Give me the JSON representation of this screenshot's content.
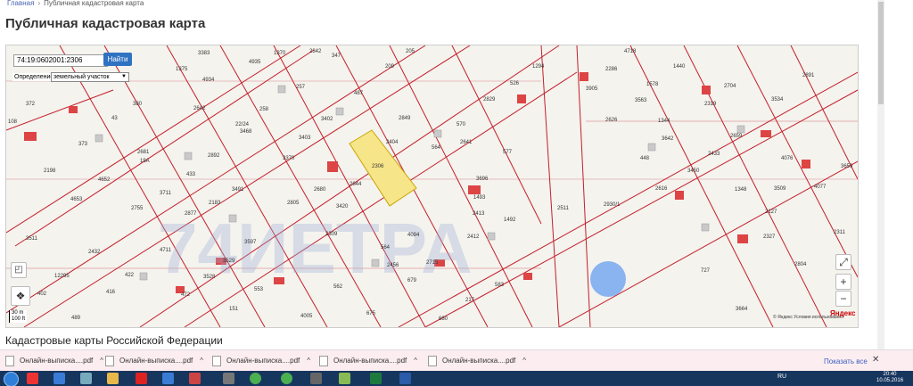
{
  "breadcrumb": {
    "home": "Главная",
    "separator": "›",
    "current": "Публичная кадастровая карта"
  },
  "page": {
    "title": "Публичная кадастровая карта",
    "section_title": "Кадастровые карты Российской Федерации"
  },
  "search": {
    "value": "74:19:0602001:2306",
    "button_label": "Найти"
  },
  "definition": {
    "label": "Определение",
    "selected": "земельный участок"
  },
  "map": {
    "labels": [
      {
        "id": "3383",
        "t": "3383"
      },
      {
        "id": "2342",
        "t": "2342"
      },
      {
        "id": "347",
        "t": "347"
      },
      {
        "id": "209",
        "t": "209"
      },
      {
        "id": "205",
        "t": "205"
      },
      {
        "id": "1294",
        "t": "1294"
      },
      {
        "id": "4718",
        "t": "4718"
      },
      {
        "id": "1440",
        "t": "1440"
      },
      {
        "id": "2891",
        "t": "2891"
      },
      {
        "id": "1375",
        "t": "1375"
      },
      {
        "id": "4935",
        "t": "4935"
      },
      {
        "id": "1370",
        "t": "1370"
      },
      {
        "id": "3905",
        "t": "3905"
      },
      {
        "id": "2286",
        "t": "2286"
      },
      {
        "id": "1578",
        "t": "1578"
      },
      {
        "id": "2704",
        "t": "2704"
      },
      {
        "id": "3534",
        "t": "3534"
      },
      {
        "id": "4934",
        "t": "4934"
      },
      {
        "id": "257",
        "t": "257"
      },
      {
        "id": "487",
        "t": "487"
      },
      {
        "id": "2829",
        "t": "2829"
      },
      {
        "id": "526",
        "t": "526"
      },
      {
        "id": "3563",
        "t": "3563"
      },
      {
        "id": "2319",
        "t": "2319"
      },
      {
        "id": "372",
        "t": "372"
      },
      {
        "id": "380",
        "t": "380"
      },
      {
        "id": "2642",
        "t": "2642"
      },
      {
        "id": "258",
        "t": "258"
      },
      {
        "id": "3402",
        "t": "3402"
      },
      {
        "id": "2849",
        "t": "2849"
      },
      {
        "id": "2626",
        "t": "2626"
      },
      {
        "id": "1344",
        "t": "1344"
      },
      {
        "id": "108",
        "t": "108"
      },
      {
        "id": "43",
        "t": "43"
      },
      {
        "id": "22/24",
        "t": "22/24"
      },
      {
        "id": "3468",
        "t": "3468"
      },
      {
        "id": "570",
        "t": "570"
      },
      {
        "id": "3642",
        "t": "3642"
      },
      {
        "id": "2659",
        "t": "2659"
      },
      {
        "id": "373",
        "t": "373"
      },
      {
        "id": "3403",
        "t": "3403"
      },
      {
        "id": "2404",
        "t": "2404"
      },
      {
        "id": "564",
        "t": "564"
      },
      {
        "id": "577",
        "t": "577"
      },
      {
        "id": "448",
        "t": "448"
      },
      {
        "id": "2433",
        "t": "2433"
      },
      {
        "id": "2681",
        "t": "2681"
      },
      {
        "id": "19А",
        "t": "19А"
      },
      {
        "id": "2892",
        "t": "2892"
      },
      {
        "id": "2306",
        "t": "2306"
      },
      {
        "id": "3370",
        "t": "3370"
      },
      {
        "id": "2641",
        "t": "2641"
      },
      {
        "id": "3450",
        "t": "3450"
      },
      {
        "id": "4076",
        "t": "4076"
      },
      {
        "id": "3659",
        "t": "3659"
      },
      {
        "id": "2198",
        "t": "2198"
      },
      {
        "id": "4652",
        "t": "4652"
      },
      {
        "id": "433",
        "t": "433"
      },
      {
        "id": "2680",
        "t": "2680"
      },
      {
        "id": "2644",
        "t": "2644"
      },
      {
        "id": "3696",
        "t": "3696"
      },
      {
        "id": "2616",
        "t": "2616"
      },
      {
        "id": "1348",
        "t": "1348"
      },
      {
        "id": "3509",
        "t": "3509"
      },
      {
        "id": "4077",
        "t": "4077"
      },
      {
        "id": "4653",
        "t": "4653"
      },
      {
        "id": "3711",
        "t": "3711"
      },
      {
        "id": "3491",
        "t": "3491"
      },
      {
        "id": "2183",
        "t": "2183"
      },
      {
        "id": "2805",
        "t": "2805"
      },
      {
        "id": "3420",
        "t": "3420"
      },
      {
        "id": "1493",
        "t": "1493"
      },
      {
        "id": "2511",
        "t": "2511"
      },
      {
        "id": "2930/1",
        "t": "2930/1"
      },
      {
        "id": "2755",
        "t": "2755"
      },
      {
        "id": "2877",
        "t": "2877"
      },
      {
        "id": "2413",
        "t": "2413"
      },
      {
        "id": "1492",
        "t": "1492"
      },
      {
        "id": "2127",
        "t": "2127"
      },
      {
        "id": "2311",
        "t": "2311"
      },
      {
        "id": "3511",
        "t": "3511"
      },
      {
        "id": "4711",
        "t": "4711"
      },
      {
        "id": "3597",
        "t": "3597"
      },
      {
        "id": "2309",
        "t": "2309"
      },
      {
        "id": "4094",
        "t": "4094"
      },
      {
        "id": "2412",
        "t": "2412"
      },
      {
        "id": "2327",
        "t": "2327"
      },
      {
        "id": "2432",
        "t": "2432"
      },
      {
        "id": "3529",
        "t": "3529"
      },
      {
        "id": "564b",
        "t": "564"
      },
      {
        "id": "2456",
        "t": "2456"
      },
      {
        "id": "2715",
        "t": "2715"
      },
      {
        "id": "727",
        "t": "727"
      },
      {
        "id": "2804",
        "t": "2804"
      },
      {
        "id": "12295",
        "t": "12295"
      },
      {
        "id": "422",
        "t": "422"
      },
      {
        "id": "3528",
        "t": "3528"
      },
      {
        "id": "679",
        "t": "679"
      },
      {
        "id": "583",
        "t": "583"
      },
      {
        "id": "402",
        "t": "402"
      },
      {
        "id": "416",
        "t": "416"
      },
      {
        "id": "472",
        "t": "472"
      },
      {
        "id": "553",
        "t": "553"
      },
      {
        "id": "562",
        "t": "562"
      },
      {
        "id": "217",
        "t": "217"
      },
      {
        "id": "3664",
        "t": "3664"
      },
      {
        "id": "489",
        "t": "489"
      },
      {
        "id": "151",
        "t": "151"
      },
      {
        "id": "4005",
        "t": "4005"
      },
      {
        "id": "675",
        "t": "675"
      },
      {
        "id": "680",
        "t": "680"
      }
    ],
    "scale_m": "30 m",
    "scale_ft": "100 ft",
    "yandex_note": "© Яндекс  Условия использования",
    "yandex_logo": "Яндекс"
  },
  "downloads": {
    "items": [
      {
        "label": "Онлайн-выписка....pdf"
      },
      {
        "label": "Онлайн-выписка....pdf"
      },
      {
        "label": "Онлайн-выписка....pdf"
      },
      {
        "label": "Онлайн-выписка....pdf"
      },
      {
        "label": "Онлайн-выписка....pdf"
      }
    ],
    "show_all": "Показать все",
    "chevron": "^"
  },
  "taskbar": {
    "lang": "RU",
    "time": "20:40",
    "date": "10.05.2016"
  },
  "colors": {
    "parcel_border": "#c41e2a",
    "highlight_fill": "#f7e58a",
    "button_blue": "#3072c2",
    "watermark": "#9fb0d8"
  }
}
